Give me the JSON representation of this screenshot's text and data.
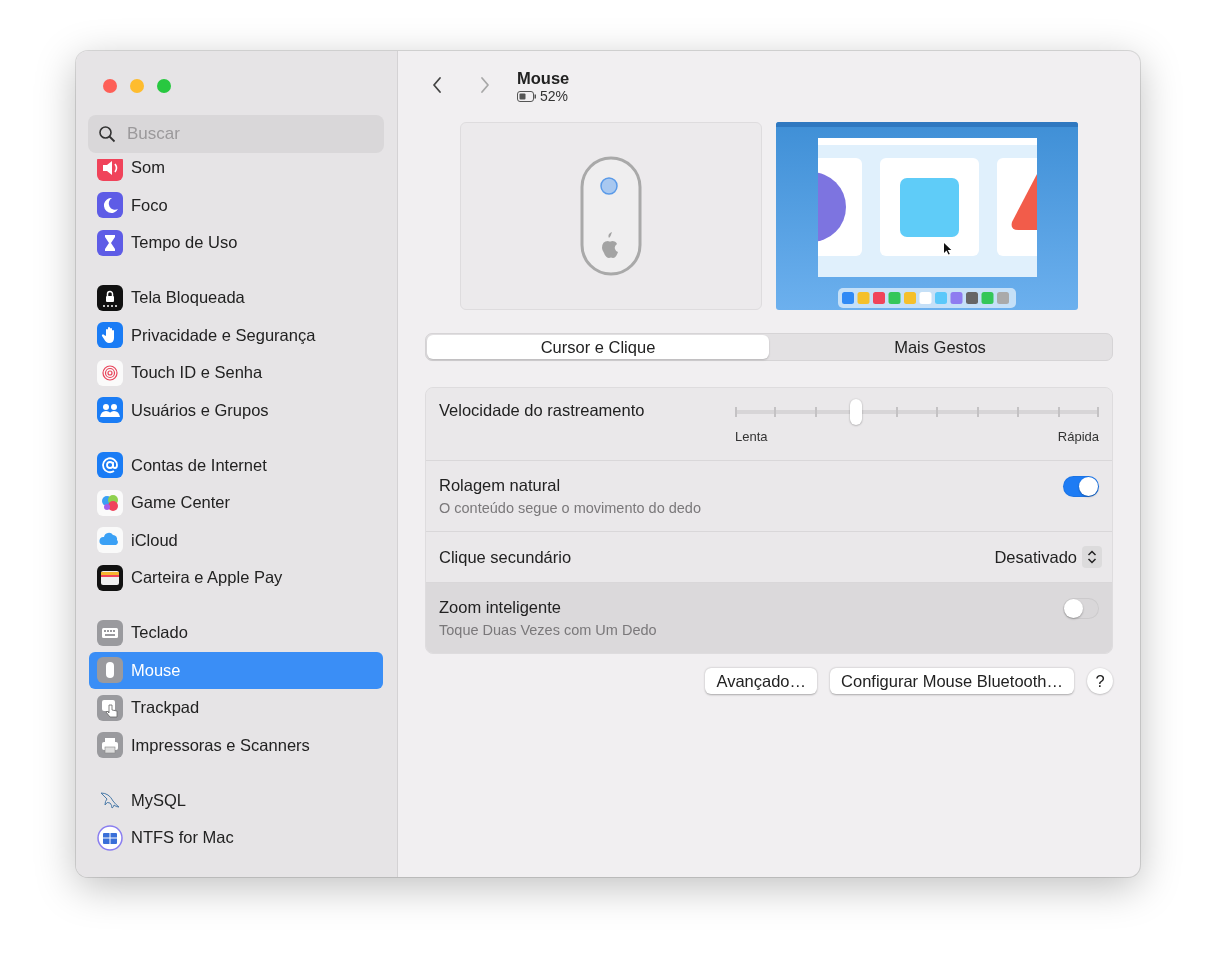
{
  "sidebar": {
    "search": {
      "placeholder": "Buscar"
    },
    "groups": [
      {
        "items": [
          {
            "label": "Som",
            "selected": false
          },
          {
            "label": "Foco",
            "selected": false
          },
          {
            "label": "Tempo de Uso",
            "selected": false
          }
        ]
      },
      {
        "items": [
          {
            "label": "Tela Bloqueada",
            "selected": false
          },
          {
            "label": "Privacidade e Segurança",
            "selected": false
          },
          {
            "label": "Touch ID e Senha",
            "selected": false
          },
          {
            "label": "Usuários e Grupos",
            "selected": false
          }
        ]
      },
      {
        "items": [
          {
            "label": "Contas de Internet",
            "selected": false
          },
          {
            "label": "Game Center",
            "selected": false
          },
          {
            "label": "iCloud",
            "selected": false
          },
          {
            "label": "Carteira e Apple Pay",
            "selected": false
          }
        ]
      },
      {
        "items": [
          {
            "label": "Teclado",
            "selected": false
          },
          {
            "label": "Mouse",
            "selected": true
          },
          {
            "label": "Trackpad",
            "selected": false
          },
          {
            "label": "Impressoras e Scanners",
            "selected": false
          }
        ]
      },
      {
        "items": [
          {
            "label": "MySQL",
            "selected": false
          },
          {
            "label": "NTFS for Mac",
            "selected": false
          }
        ]
      }
    ]
  },
  "nav": [
    {
      "kind": "back",
      "disabled": false
    },
    {
      "kind": "forward",
      "disabled": true
    }
  ],
  "header": {
    "title": "Mouse",
    "battery": "52%"
  },
  "tabs": [
    {
      "label": "Cursor e Clique",
      "selected": true
    },
    {
      "label": "Mais Gestos",
      "selected": false
    }
  ],
  "settings": [
    {
      "kind": "slider",
      "label": "Velocidade do rastreamento",
      "level": 0.3333,
      "min_label": "Lenta",
      "max_label": "Rápida",
      "highlighted": false
    },
    {
      "kind": "toggle",
      "label": "Rolagem natural",
      "description": "O conteúdo segue o movimento do dedo",
      "on": true,
      "highlighted": false
    },
    {
      "kind": "popup",
      "label": "Clique secundário",
      "value": "Desativado",
      "highlighted": false
    },
    {
      "kind": "toggle",
      "label": "Zoom inteligente",
      "description": "Toque Duas Vezes com Um Dedo",
      "on": false,
      "highlighted": true
    }
  ],
  "buttons": [
    {
      "label": "Avançado…"
    },
    {
      "label": "Configurar Mouse Bluetooth…"
    }
  ],
  "help": {
    "label": "?"
  }
}
